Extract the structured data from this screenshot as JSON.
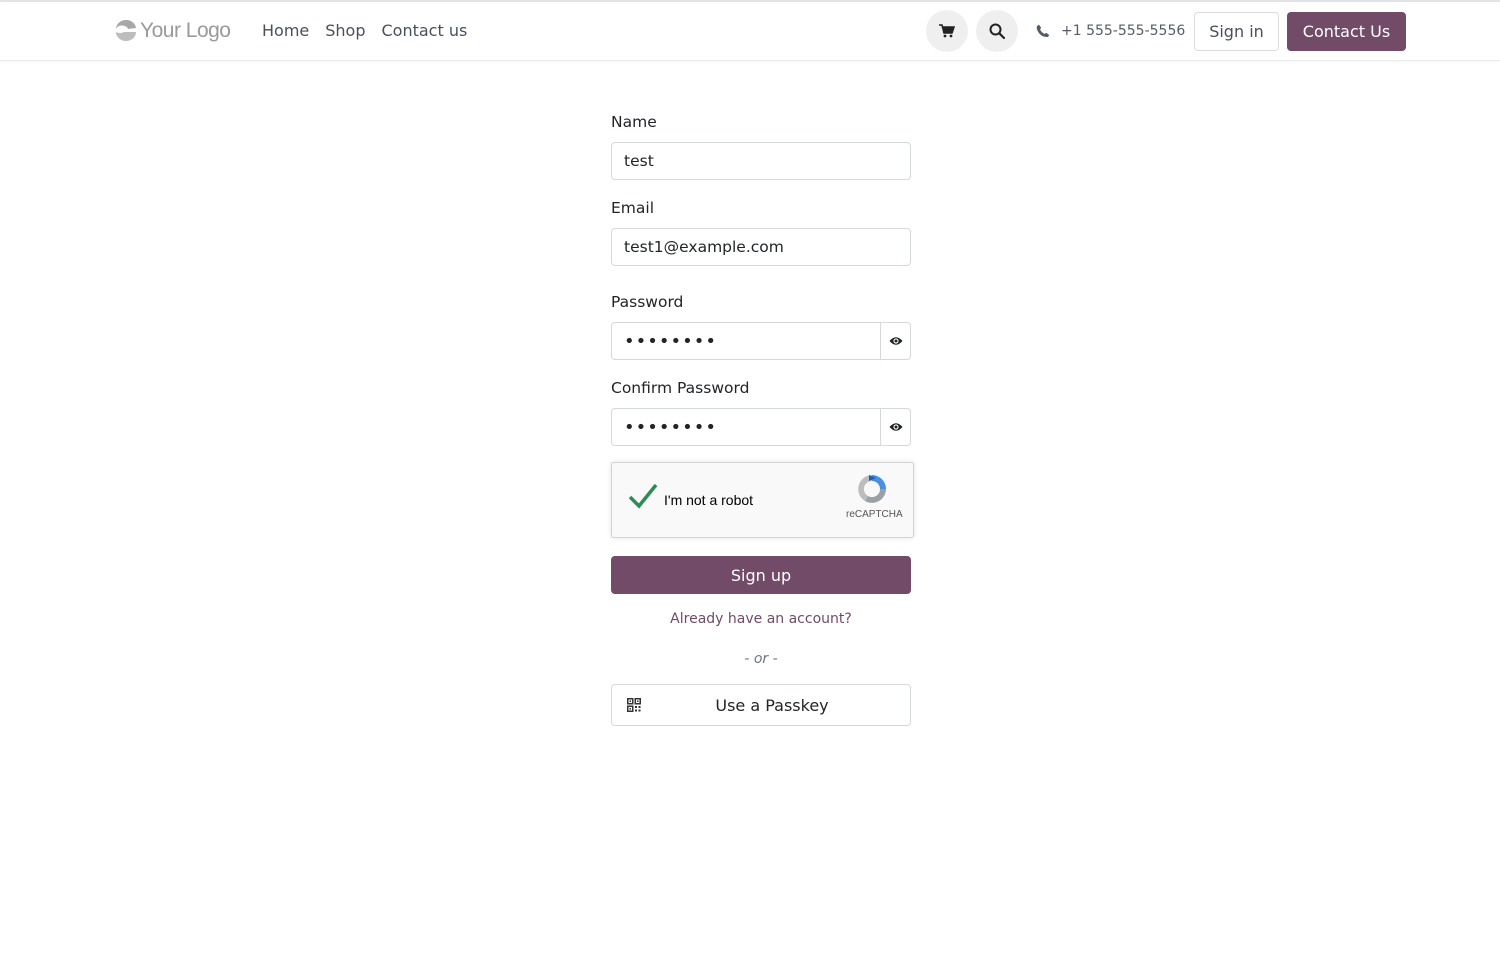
{
  "header": {
    "logo_text": "Your Logo",
    "nav": [
      "Home",
      "Shop",
      "Contact us"
    ],
    "cart_icon": "cart-icon",
    "search_icon": "search-icon",
    "phone": "+1 555-555-5556",
    "signin_label": "Sign in",
    "contact_label": "Contact Us"
  },
  "form": {
    "name_label": "Name",
    "name_value": "test",
    "email_label": "Email",
    "email_value": "test1@example.com",
    "password_label": "Password",
    "password_value": "••••••••",
    "confirm_label": "Confirm Password",
    "confirm_value": "••••••••",
    "captcha_text": "I'm not a robot",
    "captcha_brand": "reCAPTCHA",
    "signup_label": "Sign up",
    "already_link": "Already have an account?",
    "or_text": "- or -",
    "passkey_label": "Use a Passkey"
  },
  "colors": {
    "brand": "#714b67",
    "captcha_check": "#2e8b57"
  }
}
